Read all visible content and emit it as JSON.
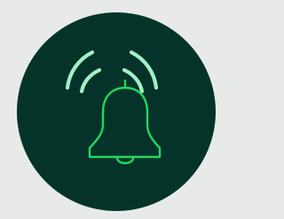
{
  "colors": {
    "background": "#e8eae9",
    "badge": "#05332a",
    "bell_outline": "#21d85d",
    "signal_waves": "#a2f0c8"
  },
  "icons": {
    "badge": "notification-badge",
    "bell": "bell-icon",
    "waves": "ringing-waves-icon"
  }
}
